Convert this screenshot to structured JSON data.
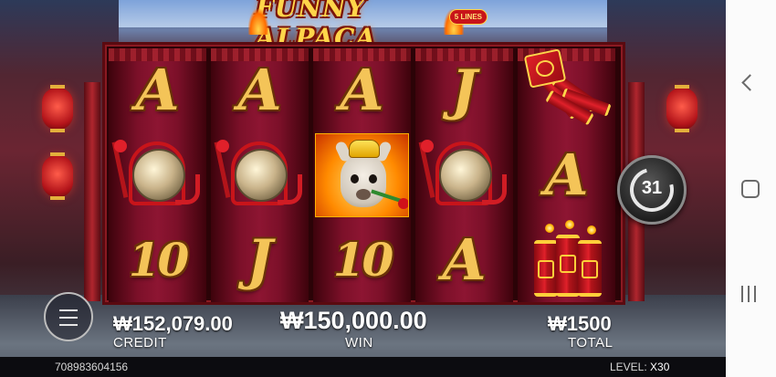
{
  "game": {
    "logo_title": "FUNNY ALPACA",
    "logo_lines": "5 LINES",
    "reels": [
      [
        "A",
        "gong",
        "10"
      ],
      [
        "A",
        "gong",
        "J"
      ],
      [
        "A",
        "alpaca",
        "10"
      ],
      [
        "J",
        "gong",
        "A"
      ],
      [
        "firecracker-bundle",
        "A",
        "big-firecrackers"
      ]
    ],
    "auto_spin_count": "31",
    "credit": {
      "value": "₩152,079.00",
      "label": "CREDIT"
    },
    "win": {
      "value": "₩150,000.00",
      "label": "WIN"
    },
    "total": {
      "value": "₩1500",
      "label": "TOTAL"
    },
    "session_id": "708983604156",
    "level": {
      "label": "LEVEL:",
      "multiplier": "X30"
    }
  },
  "icons": {
    "menu": "hamburger-menu-icon",
    "spin": "auto-spin-icon",
    "nav_back": "chevron-left-icon",
    "nav_home": "home-square-icon",
    "nav_recent": "recent-apps-icon"
  },
  "colors": {
    "accent_gold": "#f4c458",
    "reel_red": "#7c1029"
  }
}
